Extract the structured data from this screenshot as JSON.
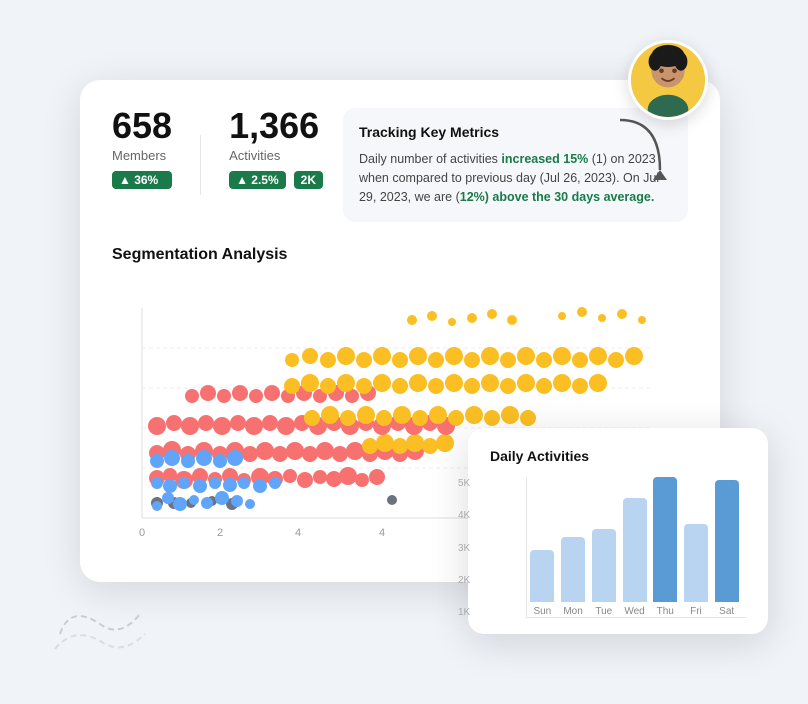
{
  "main_card": {
    "stats": {
      "members": {
        "number": "658",
        "label": "Members",
        "badge": "▲ 36%"
      },
      "activities": {
        "number": "1,366",
        "label": "Activities",
        "badge": "▲ 2.5%",
        "badge2": "2K"
      }
    },
    "tracking": {
      "title": "Tracking Key Metrics",
      "text_prefix": "Daily number of activities ",
      "highlight1": "increased 15%",
      "text_mid": " (1) on 2023 when compared to previous day (Jul 26, 2023). On Jul 29, 2023, we are (",
      "highlight2": "12%) above the 30 days average.",
      "text_suffix": ""
    },
    "segmentation_title": "Segmentation Analysis"
  },
  "daily_chart": {
    "title": "Daily Activities",
    "y_labels": [
      "5K",
      "4K",
      "3K",
      "2K",
      "1K"
    ],
    "bars": [
      {
        "day": "Sun",
        "value": 2000,
        "pct": 40,
        "active": false
      },
      {
        "day": "Mon",
        "value": 2500,
        "pct": 50,
        "active": false
      },
      {
        "day": "Tue",
        "value": 2800,
        "pct": 56,
        "active": false
      },
      {
        "day": "Wed",
        "value": 4000,
        "pct": 80,
        "active": false
      },
      {
        "day": "Thu",
        "value": 4800,
        "pct": 96,
        "active": true
      },
      {
        "day": "Fri",
        "value": 3000,
        "pct": 60,
        "active": false
      },
      {
        "day": "Sat",
        "value": 4700,
        "pct": 94,
        "active": true
      }
    ]
  },
  "colors": {
    "green": "#1a7a4a",
    "blue_bar": "#b8d4f0",
    "blue_bar_active": "#5b9bd5",
    "yellow_bg": "#f5c842"
  }
}
